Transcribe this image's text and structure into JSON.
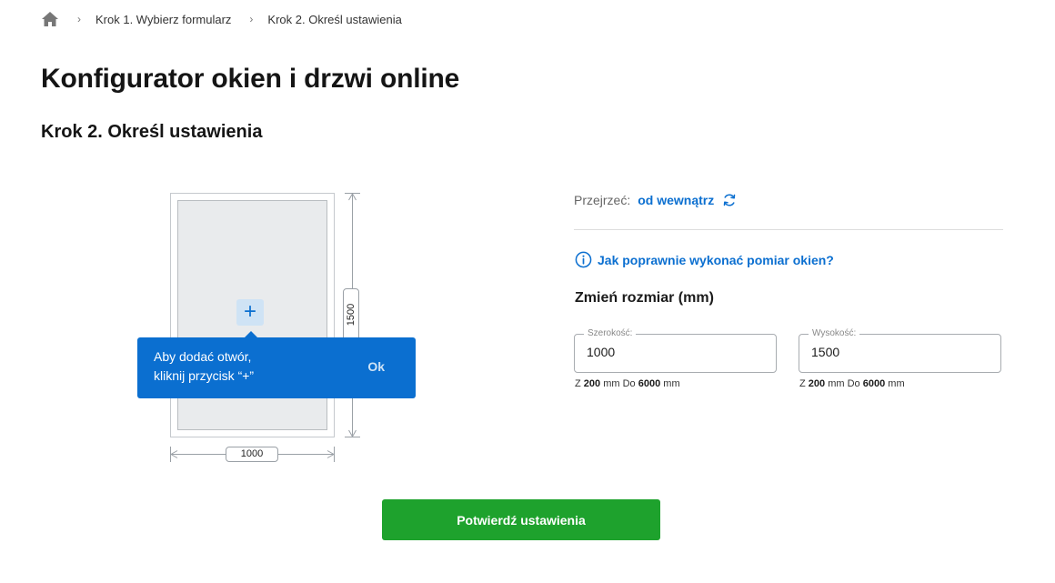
{
  "breadcrumb": {
    "items": [
      "Krok 1. Wybierz formularz",
      "Krok 2. Określ ustawienia"
    ]
  },
  "page_title": "Konfigurator okien i drzwi online",
  "step_title": "Krok 2. Określ ustawienia",
  "diagram": {
    "width_label": "1000",
    "height_label": "1500",
    "add_symbol": "+"
  },
  "tooltip": {
    "line1": "Aby dodać otwór,",
    "line2": "kliknij przycisk “+”",
    "ok_label": "Ok"
  },
  "view": {
    "label": "Przejrzeć:",
    "value": "od wewnątrz"
  },
  "measure_link": "Jak poprawnie wykonać pomiar okien?",
  "resize": {
    "title": "Zmień rozmiar (mm)",
    "width": {
      "label": "Szerokość:",
      "value": "1000",
      "prefix": "Z",
      "min": "200",
      "unit1": "mm Do",
      "max": "6000",
      "unit2": "mm"
    },
    "height": {
      "label": "Wysokość:",
      "value": "1500",
      "prefix": "Z",
      "min": "200",
      "unit1": "mm Do",
      "max": "6000",
      "unit2": "mm"
    }
  },
  "confirm_label": "Potwierdź ustawienia",
  "colors": {
    "accent": "#0b6fd0",
    "confirm": "#1ea22d"
  },
  "icons": [
    "home-icon",
    "chevron-right-icon",
    "refresh-icon",
    "info-icon"
  ]
}
